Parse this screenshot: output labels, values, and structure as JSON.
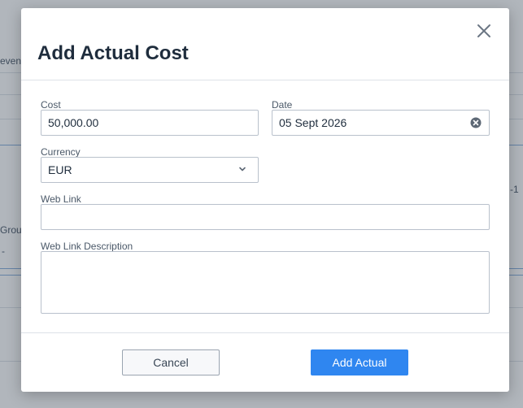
{
  "background": {
    "column_fragment": "even",
    "group_fragment": "Grou",
    "dash": "-",
    "row_suffix": "-1"
  },
  "modal": {
    "title": "Add Actual Cost",
    "close_icon": "close-icon",
    "fields": {
      "cost": {
        "label": "Cost",
        "value": "50,000.00"
      },
      "date": {
        "label": "Date",
        "value": "05 Sept 2026"
      },
      "currency": {
        "label": "Currency",
        "value": "EUR"
      },
      "web_link": {
        "label": "Web Link",
        "value": ""
      },
      "web_link_description": {
        "label": "Web Link Description",
        "value": ""
      }
    },
    "buttons": {
      "cancel": "Cancel",
      "add_actual": "Add Actual"
    }
  },
  "colors": {
    "primary": "#2f86f0",
    "title": "#1f2d3d",
    "border": "#b9c1cc"
  }
}
